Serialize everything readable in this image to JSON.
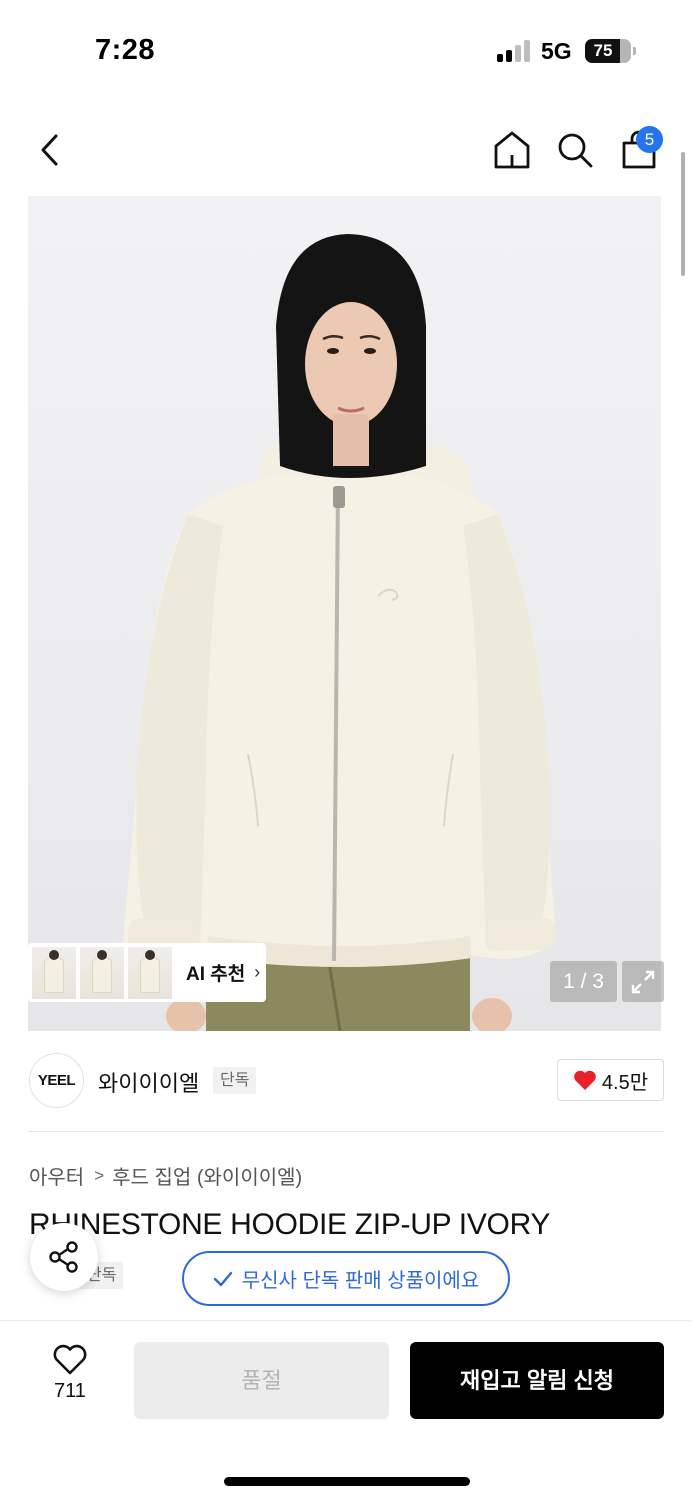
{
  "status_bar": {
    "time": "7:28",
    "network": "5G",
    "battery_level": "75",
    "battery_fraction": 0.75
  },
  "header": {
    "back_icon": "chevron-left-icon",
    "home_icon": "home-icon",
    "search_icon": "search-icon",
    "cart_icon": "shopping-bag-icon",
    "cart_badge": "5",
    "badge_color": "#2474ef"
  },
  "gallery": {
    "ai_label": "AI 추천",
    "page_counter": "1 / 3",
    "current_page": 1,
    "total_pages": 3
  },
  "brand": {
    "logo_text": "YEEL",
    "name": "와이이이엘",
    "tag": "단독",
    "likes": "4.5만"
  },
  "product": {
    "breadcrumb": [
      "아우터",
      "후드 집업 (와이이이엘)"
    ],
    "title": "RHINESTONE HOODIE ZIP-UP IVORY",
    "tag": "단독",
    "exclusive_notice": "무신사 단독 판매 상품이에요",
    "accent_color": "#2f69d9"
  },
  "bottom_bar": {
    "wish_count": "711",
    "soldout_label": "품절",
    "restock_label": "재입고 알림 신청"
  }
}
